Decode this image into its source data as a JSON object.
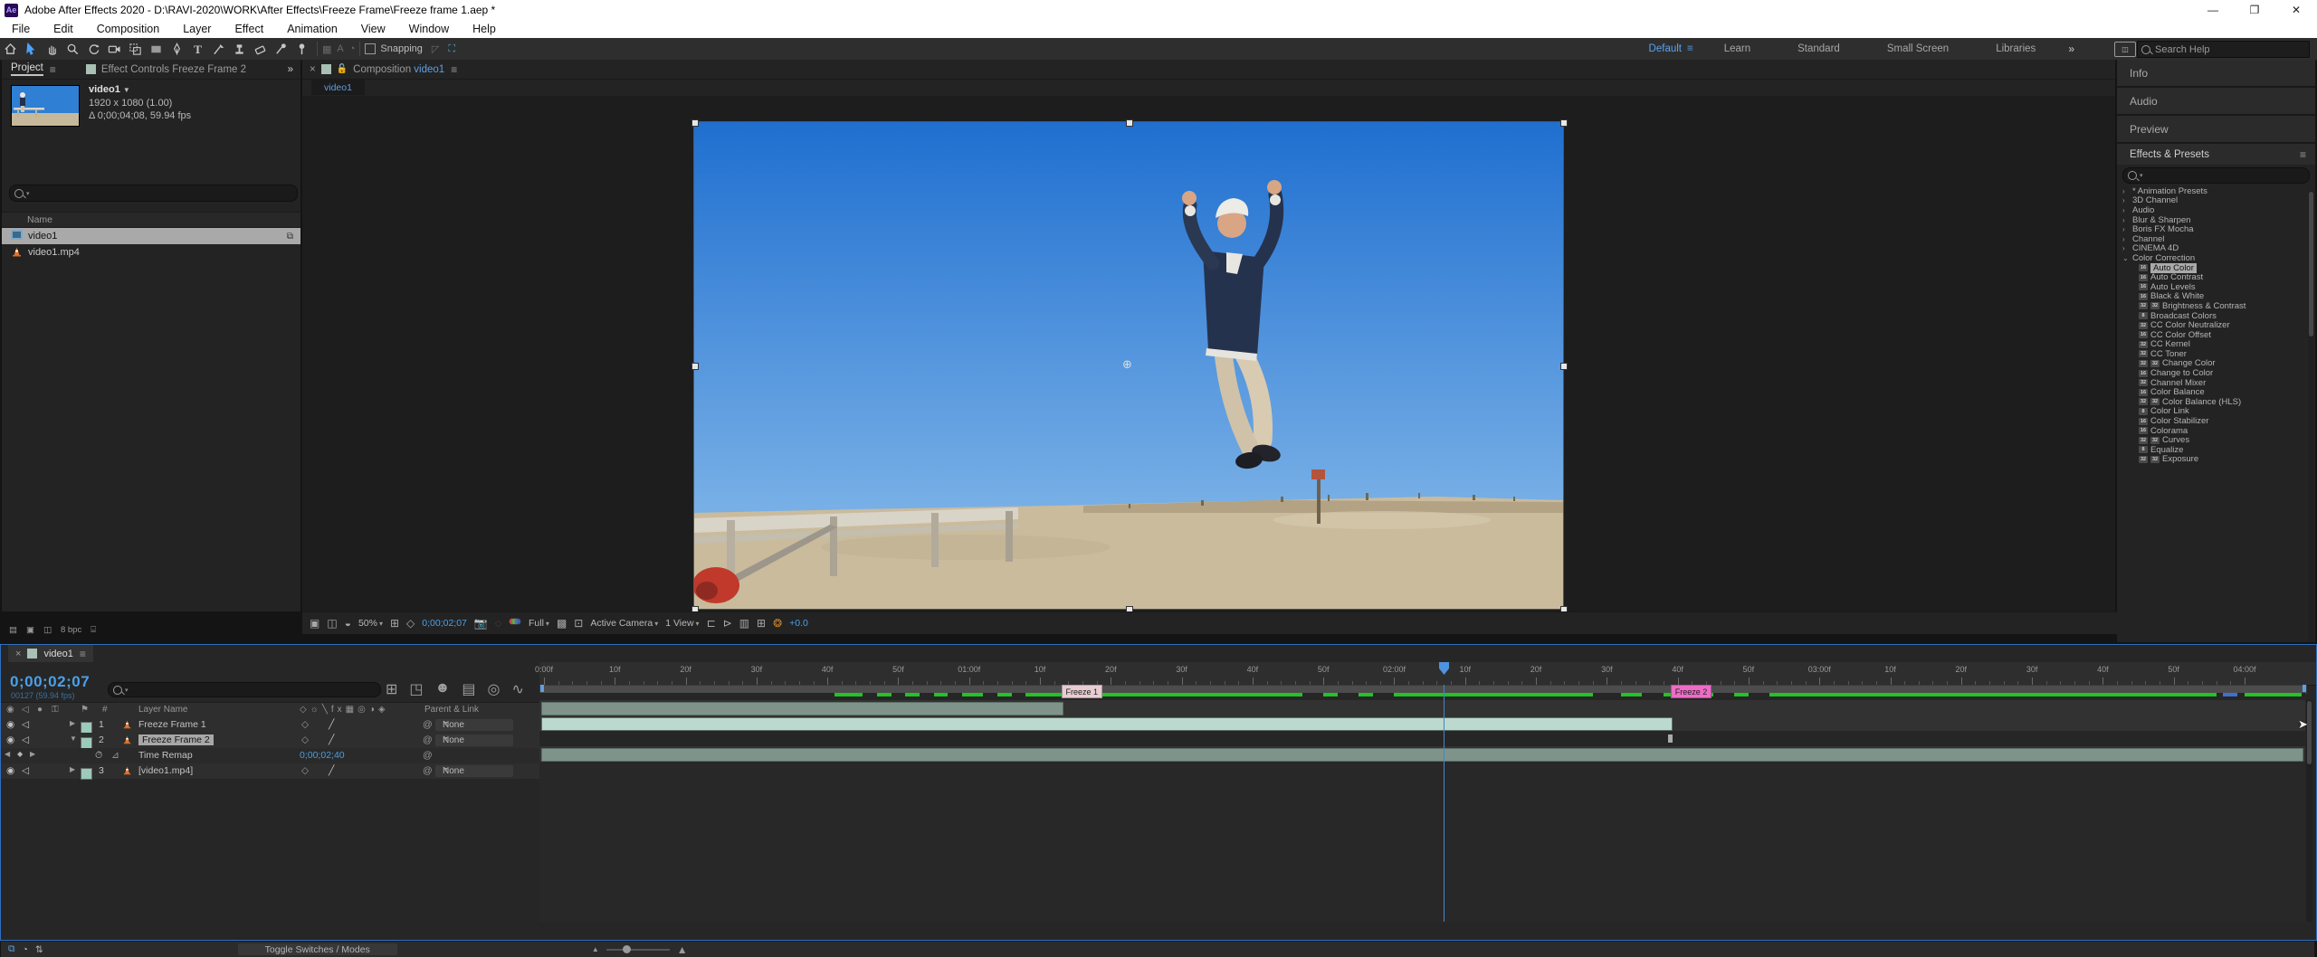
{
  "window": {
    "title": "Adobe After Effects 2020 - D:\\RAVI-2020\\WORK\\After Effects\\Freeze Frame\\Freeze frame 1.aep *",
    "app_icon": "Ae",
    "controls": {
      "minimize": "—",
      "maximize": "❐",
      "close": "✕"
    }
  },
  "menu": [
    "File",
    "Edit",
    "Composition",
    "Layer",
    "Effect",
    "Animation",
    "View",
    "Window",
    "Help"
  ],
  "toolbar": {
    "tools": [
      "home",
      "selection",
      "hand",
      "zoom",
      "rotate",
      "camera",
      "pan-behind",
      "shape",
      "pen",
      "type",
      "brush",
      "clone-stamp",
      "eraser",
      "roto-brush",
      "puppet-pin"
    ],
    "active_tool": "selection",
    "snapping_label": "Snapping",
    "workspaces": [
      "Default",
      "Learn",
      "Standard",
      "Small Screen",
      "Libraries"
    ],
    "active_workspace": "Default",
    "overflow_chevron": "»",
    "search_placeholder": "Search Help"
  },
  "project_panel": {
    "tabs": [
      "Project",
      "Effect Controls Freeze Frame 2"
    ],
    "active_tab": "Project",
    "overflow_chevron": "»",
    "preview": {
      "name": "video1",
      "resolution": "1920 x 1080 (1.00)",
      "duration": "Δ 0;00;04;08, 59.94 fps"
    },
    "name_column": "Name",
    "items": [
      {
        "name": "video1",
        "type": "composition",
        "selected": true
      },
      {
        "name": "video1.mp4",
        "type": "footage",
        "selected": false
      }
    ],
    "footer_bit_depth": "8 bpc"
  },
  "composition_panel": {
    "close": "×",
    "tab_prefix": "Composition",
    "tab_name": "video1",
    "viewer_tab": "video1",
    "toolbar": {
      "zoom": "50%",
      "timecode": "0;00;02;07",
      "resolution": "Full",
      "camera": "Active Camera",
      "view_layout": "1 View",
      "exposure": "+0.0"
    }
  },
  "right_panel": {
    "collapsed": [
      "Info",
      "Audio",
      "Preview"
    ],
    "effects": {
      "title": "Effects & Presets",
      "categories": [
        {
          "label": "* Animation Presets",
          "expanded": false
        },
        {
          "label": "3D Channel",
          "expanded": false
        },
        {
          "label": "Audio",
          "expanded": false
        },
        {
          "label": "Blur & Sharpen",
          "expanded": false
        },
        {
          "label": "Boris FX Mocha",
          "expanded": false
        },
        {
          "label": "Channel",
          "expanded": false
        },
        {
          "label": "CINEMA 4D",
          "expanded": false
        },
        {
          "label": "Color Correction",
          "expanded": true
        }
      ],
      "color_correction_items": [
        {
          "badges": [
            "16"
          ],
          "name": "Auto Color",
          "selected": true
        },
        {
          "badges": [
            "16"
          ],
          "name": "Auto Contrast"
        },
        {
          "badges": [
            "16"
          ],
          "name": "Auto Levels"
        },
        {
          "badges": [
            "16"
          ],
          "name": "Black & White"
        },
        {
          "badges": [
            "32",
            "32"
          ],
          "name": "Brightness & Contrast"
        },
        {
          "badges": [
            "8"
          ],
          "name": "Broadcast Colors"
        },
        {
          "badges": [
            "32"
          ],
          "name": "CC Color Neutralizer"
        },
        {
          "badges": [
            "16"
          ],
          "name": "CC Color Offset"
        },
        {
          "badges": [
            "32"
          ],
          "name": "CC Kernel"
        },
        {
          "badges": [
            "32"
          ],
          "name": "CC Toner"
        },
        {
          "badges": [
            "32",
            "32"
          ],
          "name": "Change Color"
        },
        {
          "badges": [
            "16"
          ],
          "name": "Change to Color"
        },
        {
          "badges": [
            "32"
          ],
          "name": "Channel Mixer"
        },
        {
          "badges": [
            "16"
          ],
          "name": "Color Balance"
        },
        {
          "badges": [
            "32",
            "32"
          ],
          "name": "Color Balance (HLS)"
        },
        {
          "badges": [
            "8"
          ],
          "name": "Color Link"
        },
        {
          "badges": [
            "16"
          ],
          "name": "Color Stabilizer"
        },
        {
          "badges": [
            "16"
          ],
          "name": "Colorama"
        },
        {
          "badges": [
            "32",
            "32"
          ],
          "name": "Curves"
        },
        {
          "badges": [
            "8"
          ],
          "name": "Equalize"
        },
        {
          "badges": [
            "32",
            "32"
          ],
          "name": "Exposure"
        }
      ]
    }
  },
  "timeline": {
    "tab": "video1",
    "timecode": "0;00;02;07",
    "frame_info": "00127 (59.94 fps)",
    "columns": {
      "layer_name": "Layer Name",
      "parent_link": "Parent & Link"
    },
    "ruler_labels": [
      "0:00f",
      "10f",
      "20f",
      "30f",
      "40f",
      "50f",
      "01:00f",
      "10f",
      "20f",
      "30f",
      "40f",
      "50f",
      "02:00f",
      "10f",
      "20f",
      "30f",
      "40f",
      "50f",
      "03:00f",
      "10f",
      "20f",
      "30f",
      "40f",
      "50f",
      "04:00f"
    ],
    "playhead_frame": 127,
    "markers": [
      {
        "label": "Freeze 1",
        "frame": 73
      },
      {
        "label": "Freeze 2",
        "frame": 159
      }
    ],
    "layers": [
      {
        "index": "1",
        "name": "Freeze Frame 1",
        "parent": "None",
        "selected": false,
        "expanded": false,
        "bar_end_frame": 73
      },
      {
        "index": "2",
        "name": "Freeze Frame 2",
        "parent": "None",
        "selected": true,
        "expanded": true,
        "bar_end_frame": 159,
        "property": {
          "name": "Time Remap",
          "value": "0;00;02;40",
          "keyframe_frame": 159
        }
      },
      {
        "index": "3",
        "name": "[video1.mp4]",
        "parent": "None",
        "selected": false,
        "expanded": false,
        "bar_end_frame": 248
      }
    ],
    "cache_segments": [
      [
        41,
        45
      ],
      [
        47,
        49
      ],
      [
        51,
        53
      ],
      [
        55,
        57
      ],
      [
        59,
        62
      ],
      [
        64,
        66
      ],
      [
        68,
        73
      ],
      [
        75,
        107
      ],
      [
        110,
        112
      ],
      [
        115,
        117
      ],
      [
        120,
        148
      ],
      [
        152,
        155
      ],
      [
        158,
        160
      ],
      [
        163,
        165
      ],
      [
        168,
        170
      ],
      [
        173,
        236
      ],
      [
        240,
        248
      ]
    ],
    "cache_blue_segment": [
      237,
      239
    ],
    "bottom": {
      "toggle_label": "Toggle Switches / Modes"
    }
  },
  "colors": {
    "accent_blue": "#4ba0e8",
    "selection_gray": "#a8a8a8",
    "cache_green": "#23c225",
    "marker1_pink": "#e7ccd1",
    "marker2_pink": "#ee6cc6",
    "layer_bar": "#7e948b",
    "layer_bar_selected": "#bcd9cf",
    "label_swatch": "#9ccabb"
  }
}
